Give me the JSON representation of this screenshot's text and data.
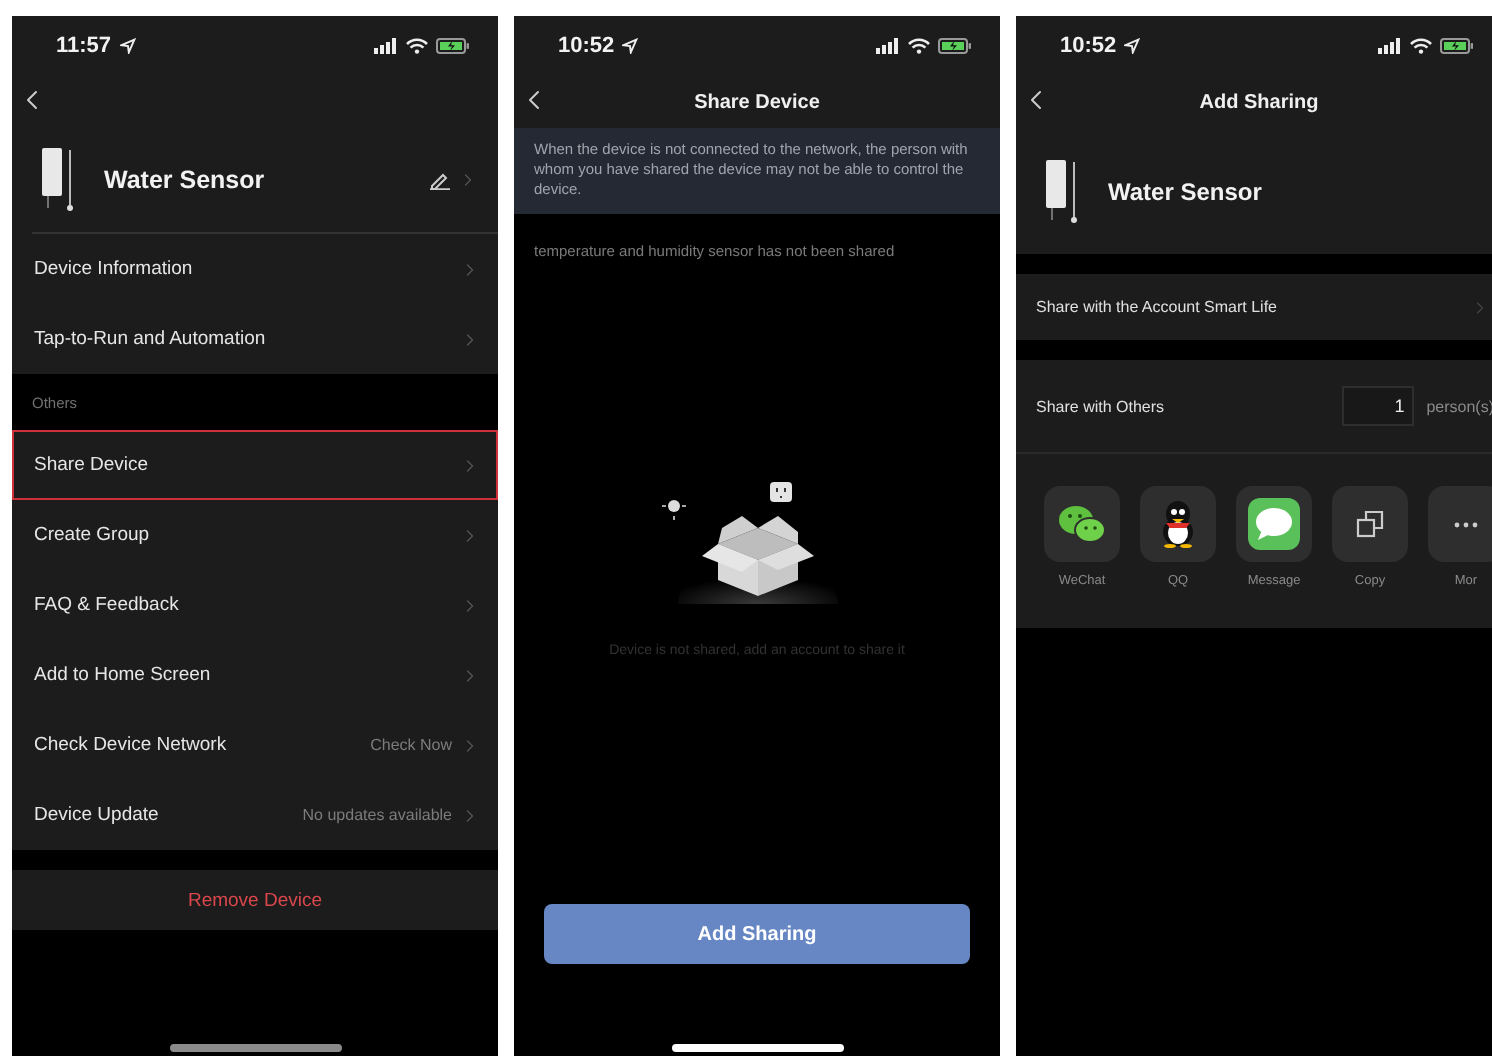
{
  "screens": [
    {
      "kind": "device_settings",
      "time": "11:57",
      "device_name": "Water Sensor",
      "sections": [
        {
          "items": [
            {
              "label": "Device Information",
              "highlighted": false
            },
            {
              "label": "Tap-to-Run and Automation",
              "highlighted": false
            }
          ]
        },
        {
          "label": "Others",
          "items": [
            {
              "label": "Share Device",
              "highlighted": true
            },
            {
              "label": "Create Group",
              "highlighted": false
            },
            {
              "label": "FAQ & Feedback",
              "highlighted": false
            },
            {
              "label": "Add to Home Screen",
              "highlighted": false
            },
            {
              "label": "Check Device Network",
              "value": "Check Now",
              "highlighted": false
            },
            {
              "label": "Device Update",
              "value": "No updates available",
              "highlighted": false
            }
          ]
        }
      ],
      "remove_button": "Remove Device"
    },
    {
      "kind": "share_device",
      "time": "10:52",
      "title": "Share Device",
      "notice": "When the device is not connected to the network, the person with whom you have shared the device may not be able to control the device.",
      "shared_status": "temperature and humidity sensor has not been shared",
      "empty_message": "Device is not shared, add an account to share it",
      "button": "Add Sharing"
    },
    {
      "kind": "add_sharing",
      "time": "10:52",
      "title": "Add Sharing",
      "device_name": "Water Sensor",
      "account_row": "Share with the Account Smart Life",
      "others_label": "Share with Others",
      "count": "1",
      "unit": "person(s)",
      "share_targets": [
        {
          "kind": "wechat",
          "label": "WeChat"
        },
        {
          "kind": "qq",
          "label": "QQ"
        },
        {
          "kind": "message",
          "label": "Message"
        },
        {
          "kind": "copy",
          "label": "Copy"
        },
        {
          "kind": "more",
          "label": "Mor"
        }
      ]
    }
  ]
}
